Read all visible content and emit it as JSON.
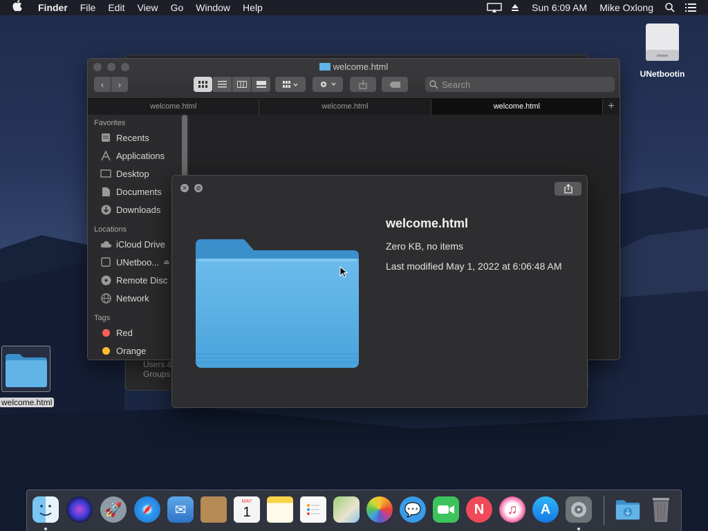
{
  "menubar": {
    "app": "Finder",
    "menus": [
      "File",
      "Edit",
      "View",
      "Go",
      "Window",
      "Help"
    ],
    "clock": "Sun 6:09 AM",
    "user": "Mike Oxlong"
  },
  "desktop": {
    "drive_label": "UNetbootin",
    "file_label": "welcome.html"
  },
  "finder": {
    "title": "welcome.html",
    "search_placeholder": "Search",
    "tabs": [
      "welcome.html",
      "welcome.html",
      "welcome.html"
    ],
    "sidebar": {
      "favorites_header": "Favorites",
      "favorites": [
        "Recents",
        "Applications",
        "Desktop",
        "Documents",
        "Downloads"
      ],
      "locations_header": "Locations",
      "locations": [
        "iCloud Drive",
        "UNetboo...",
        "Remote Disc",
        "Network"
      ],
      "tags_header": "Tags",
      "tags": [
        {
          "label": "Red",
          "color": "#ff5f57"
        },
        {
          "label": "Orange",
          "color": "#ffbd2e"
        }
      ]
    },
    "back_window_text": "Users & Groups"
  },
  "quicklook": {
    "name": "welcome.html",
    "size": "Zero KB, no items",
    "modified": "Last modified May 1, 2022 at 6:06:48 AM"
  },
  "dock": {
    "apps": [
      "finder",
      "siri",
      "launchpad",
      "safari",
      "mail",
      "contacts",
      "calendar",
      "notes",
      "reminders",
      "maps",
      "photos",
      "messages",
      "facetime",
      "news",
      "itunes",
      "app-store",
      "system-preferences",
      "downloads",
      "trash"
    ],
    "calendar_month": "MAY",
    "calendar_day": "1"
  },
  "colors": {
    "folder_blue": "#5fb3e6",
    "accent": "#3a87d8"
  }
}
